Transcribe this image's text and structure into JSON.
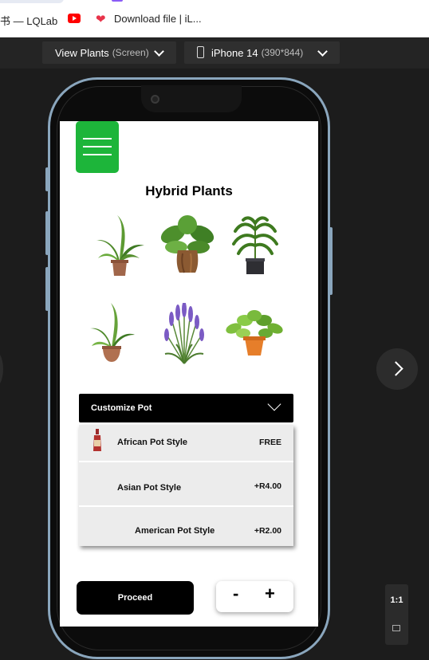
{
  "bookmarks": {
    "items": [
      {
        "label": "书 — LQLab"
      },
      {
        "icon": "youtube-icon"
      },
      {
        "icon": "heart-icon",
        "label": "Download file | iL..."
      }
    ]
  },
  "toolbar": {
    "view_label": "View Plants",
    "view_sub": "(Screen)",
    "device_label": "iPhone 14",
    "device_sub": "(390*844)"
  },
  "app": {
    "title": "Hybrid Plants",
    "customize_label": "Customize Pot",
    "pot_styles": [
      {
        "name": "African Pot Style",
        "price": "FREE"
      },
      {
        "name": "Asian Pot Style",
        "price": "+R4.00"
      },
      {
        "name": "American Pot Style",
        "price": "+R2.00"
      }
    ],
    "proceed_label": "Proceed",
    "minus": "-",
    "plus": "+"
  },
  "zoom": {
    "label": "1:1"
  },
  "colors": {
    "accent_green": "#1db53a",
    "phone_frame": "#8aa6bd"
  }
}
